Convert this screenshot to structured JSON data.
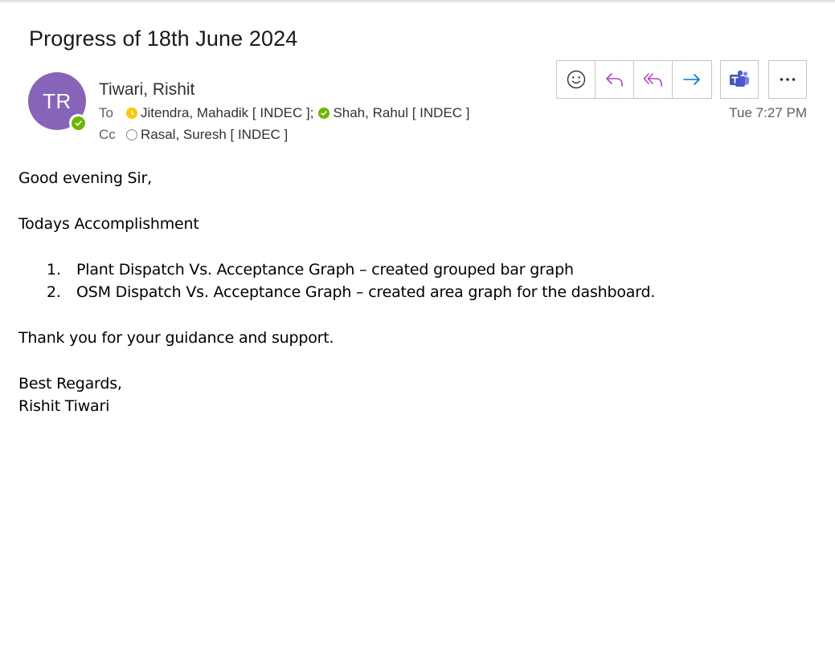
{
  "email": {
    "subject": "Progress of 18th June 2024",
    "sender": {
      "initials": "TR",
      "name": "Tiwari, Rishit",
      "avatar_color": "#8764b8",
      "presence": "available"
    },
    "to_label": "To",
    "cc_label": "Cc",
    "to": [
      {
        "name": "Jitendra, Mahadik [ INDEC ]",
        "separator": ";",
        "presence": "away"
      },
      {
        "name": "Shah, Rahul [ INDEC ]",
        "separator": "",
        "presence": "available"
      }
    ],
    "cc": [
      {
        "name": "Rasal, Suresh [ INDEC ]",
        "presence": "offline"
      }
    ],
    "timestamp": "Tue 7:27 PM"
  },
  "toolbar": {
    "icons": [
      "emoji-icon",
      "reply-icon",
      "reply-all-icon",
      "forward-icon",
      "teams-icon",
      "more-icon"
    ],
    "accent_reply": "#b146c2",
    "accent_forward": "#0078d4"
  },
  "body": {
    "greeting": "Good evening Sir,",
    "section_title": "Todays Accomplishment",
    "items": [
      {
        "num": "1.",
        "text": "Plant Dispatch Vs. Acceptance Graph – created grouped bar graph"
      },
      {
        "num": "2.",
        "text": "OSM Dispatch Vs. Acceptance Graph – created area graph for the dashboard."
      }
    ],
    "thanks": "Thank you for your guidance and support.",
    "closing": "Best Regards,",
    "signature": "Rishit Tiwari"
  }
}
